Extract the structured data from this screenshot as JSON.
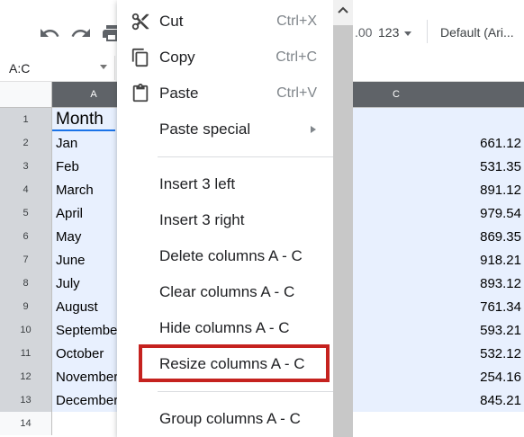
{
  "toolbar": {
    "format_123": "123",
    "font": "Default (Ari..."
  },
  "namebox": {
    "value": "A:C"
  },
  "columns": [
    {
      "label": "A"
    },
    {
      "label": "C"
    }
  ],
  "rows": [
    {
      "num": "1",
      "a": "Month",
      "c": ""
    },
    {
      "num": "2",
      "a": "Jan",
      "c": "661.12"
    },
    {
      "num": "3",
      "a": "Feb",
      "c": "531.35"
    },
    {
      "num": "4",
      "a": "March",
      "c": "891.12"
    },
    {
      "num": "5",
      "a": "April",
      "c": "979.54"
    },
    {
      "num": "6",
      "a": "May",
      "c": "869.35"
    },
    {
      "num": "7",
      "a": "June",
      "c": "918.21"
    },
    {
      "num": "8",
      "a": "July",
      "c": "893.12"
    },
    {
      "num": "9",
      "a": "August",
      "c": "761.34"
    },
    {
      "num": "10",
      "a": "September",
      "c": "593.21"
    },
    {
      "num": "11",
      "a": "October",
      "c": "532.12"
    },
    {
      "num": "12",
      "a": "November",
      "c": "254.16"
    },
    {
      "num": "13",
      "a": "December",
      "c": "845.21"
    },
    {
      "num": "14",
      "a": "",
      "c": ""
    }
  ],
  "menu": {
    "cut": {
      "label": "Cut",
      "shortcut": "Ctrl+X"
    },
    "copy": {
      "label": "Copy",
      "shortcut": "Ctrl+C"
    },
    "paste": {
      "label": "Paste",
      "shortcut": "Ctrl+V"
    },
    "paste_special": {
      "label": "Paste special"
    },
    "insert_left": {
      "label": "Insert 3 left"
    },
    "insert_right": {
      "label": "Insert 3 right"
    },
    "delete_cols": {
      "label": "Delete columns A - C"
    },
    "clear_cols": {
      "label": "Clear columns A - C"
    },
    "hide_cols": {
      "label": "Hide columns A - C"
    },
    "resize_cols": {
      "label": "Resize columns A - C"
    },
    "group_cols": {
      "label": "Group columns A - C"
    }
  },
  "colors": {
    "selection": "#e8f0fe",
    "header_selected": "#5f6368",
    "highlight": "#c5221f",
    "active_border": "#1a73e8"
  },
  "icons": [
    "undo-icon",
    "redo-icon",
    "print-icon",
    "cut-icon",
    "copy-icon",
    "paste-icon",
    "chevron-up-icon",
    "submenu-arrow-icon"
  ]
}
